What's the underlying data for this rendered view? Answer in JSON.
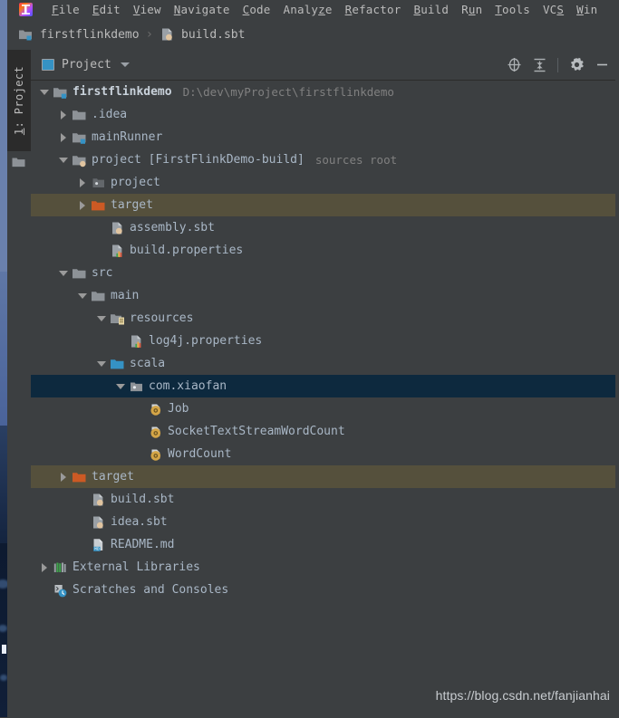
{
  "window": {
    "app_logo": "intellij-idea-logo"
  },
  "menu": {
    "items": [
      {
        "label": "File",
        "mnemonic_index": 0
      },
      {
        "label": "Edit",
        "mnemonic_index": 0
      },
      {
        "label": "View",
        "mnemonic_index": 0
      },
      {
        "label": "Navigate",
        "mnemonic_index": 0
      },
      {
        "label": "Code",
        "mnemonic_index": 0
      },
      {
        "label": "Analyze",
        "mnemonic_index": 5
      },
      {
        "label": "Refactor",
        "mnemonic_index": 0
      },
      {
        "label": "Build",
        "mnemonic_index": 0
      },
      {
        "label": "Run",
        "mnemonic_index": 1
      },
      {
        "label": "Tools",
        "mnemonic_index": 0
      },
      {
        "label": "VCS",
        "mnemonic_index": 2
      },
      {
        "label": "Win",
        "mnemonic_index": 0
      }
    ]
  },
  "breadcrumb": {
    "items": [
      {
        "label": "firstflinkdemo",
        "icon": "module-folder-icon"
      },
      {
        "label": "build.sbt",
        "icon": "sbt-file-icon"
      }
    ],
    "separator": "›"
  },
  "left_stripe": {
    "project_tab": {
      "number": "1:",
      "label": "Project"
    },
    "folder_button_icon": "folder-icon"
  },
  "project_panel": {
    "title": "Project",
    "view_icon": "project-view-icon",
    "dropdown_caret": "chevron-down-icon",
    "actions": [
      {
        "name": "select-opened-file-button",
        "icon": "locate-crosshair-icon"
      },
      {
        "name": "collapse-all-button",
        "icon": "collapse-all-icon"
      },
      {
        "name": "settings-button",
        "icon": "gear-icon"
      },
      {
        "name": "hide-button",
        "icon": "minimize-icon"
      }
    ]
  },
  "tree": {
    "rows": [
      {
        "indent": 0,
        "arrow": "expanded",
        "icon": "module-folder-icon",
        "label": "firstflinkdemo",
        "bold": true,
        "hint": "D:\\dev\\myProject\\firstflinkdemo",
        "state": "normal"
      },
      {
        "indent": 1,
        "arrow": "collapsed",
        "icon": "folder-icon",
        "label": ".idea",
        "bold": false,
        "hint": "",
        "state": "normal"
      },
      {
        "indent": 1,
        "arrow": "collapsed",
        "icon": "module-folder-icon",
        "label": "mainRunner",
        "bold": false,
        "hint": "",
        "state": "normal"
      },
      {
        "indent": 1,
        "arrow": "expanded",
        "icon": "sbt-module-folder-icon",
        "label": "project [FirstFlinkDemo-build]",
        "bold": false,
        "hint": "sources root",
        "state": "normal"
      },
      {
        "indent": 2,
        "arrow": "collapsed",
        "icon": "source-folder-icon",
        "label": "project",
        "bold": false,
        "hint": "",
        "state": "normal"
      },
      {
        "indent": 2,
        "arrow": "collapsed",
        "icon": "excluded-folder-icon",
        "label": "target",
        "bold": false,
        "hint": "",
        "state": "excluded"
      },
      {
        "indent": 3,
        "arrow": "none",
        "icon": "sbt-file-icon",
        "label": "assembly.sbt",
        "bold": false,
        "hint": "",
        "state": "normal"
      },
      {
        "indent": 3,
        "arrow": "none",
        "icon": "properties-file-icon",
        "label": "build.properties",
        "bold": false,
        "hint": "",
        "state": "normal"
      },
      {
        "indent": 1,
        "arrow": "expanded",
        "icon": "folder-icon",
        "label": "src",
        "bold": false,
        "hint": "",
        "state": "normal"
      },
      {
        "indent": 2,
        "arrow": "expanded",
        "icon": "folder-icon",
        "label": "main",
        "bold": false,
        "hint": "",
        "state": "normal"
      },
      {
        "indent": 3,
        "arrow": "expanded",
        "icon": "resources-folder-icon",
        "label": "resources",
        "bold": false,
        "hint": "",
        "state": "normal"
      },
      {
        "indent": 4,
        "arrow": "none",
        "icon": "properties-file-icon",
        "label": "log4j.properties",
        "bold": false,
        "hint": "",
        "state": "normal"
      },
      {
        "indent": 3,
        "arrow": "expanded",
        "icon": "sources-root-folder-icon",
        "label": "scala",
        "bold": false,
        "hint": "",
        "state": "normal"
      },
      {
        "indent": 4,
        "arrow": "expanded",
        "icon": "package-icon",
        "label": "com.xiaofan",
        "bold": false,
        "hint": "",
        "state": "selected"
      },
      {
        "indent": 5,
        "arrow": "none",
        "icon": "scala-object-icon",
        "label": "Job",
        "bold": false,
        "hint": "",
        "state": "normal"
      },
      {
        "indent": 5,
        "arrow": "none",
        "icon": "scala-object-icon",
        "label": "SocketTextStreamWordCount",
        "bold": false,
        "hint": "",
        "state": "normal"
      },
      {
        "indent": 5,
        "arrow": "none",
        "icon": "scala-object-icon",
        "label": "WordCount",
        "bold": false,
        "hint": "",
        "state": "normal"
      },
      {
        "indent": 1,
        "arrow": "collapsed",
        "icon": "excluded-folder-icon",
        "label": "target",
        "bold": false,
        "hint": "",
        "state": "excluded"
      },
      {
        "indent": 2,
        "arrow": "none",
        "icon": "sbt-file-icon",
        "label": "build.sbt",
        "bold": false,
        "hint": "",
        "state": "normal"
      },
      {
        "indent": 2,
        "arrow": "none",
        "icon": "sbt-file-icon",
        "label": "idea.sbt",
        "bold": false,
        "hint": "",
        "state": "normal"
      },
      {
        "indent": 2,
        "arrow": "none",
        "icon": "markdown-file-icon",
        "label": "README.md",
        "bold": false,
        "hint": "",
        "state": "normal"
      },
      {
        "indent": 0,
        "arrow": "collapsed",
        "icon": "external-libraries-icon",
        "label": "External Libraries",
        "bold": false,
        "hint": "",
        "state": "normal"
      },
      {
        "indent": 0,
        "arrow": "none",
        "icon": "scratches-icon",
        "label": "Scratches and Consoles",
        "bold": false,
        "hint": "",
        "state": "normal"
      }
    ]
  },
  "watermark": {
    "text": "https://blog.csdn.net/fanjianhai"
  },
  "colors": {
    "window_bg": "#3c3f41",
    "stripe_active_bg": "#2b2b2b",
    "selection_bg": "#0d293e",
    "excluded_bg": "#55503c",
    "text": "#a9b7c6",
    "menu_text": "#bbbbbb",
    "hint_text": "#808080",
    "folder": "#8d9297",
    "excluded_folder": "#cc5a24",
    "sources_folder": "#3592c4",
    "scala_object": "#d4a547"
  }
}
